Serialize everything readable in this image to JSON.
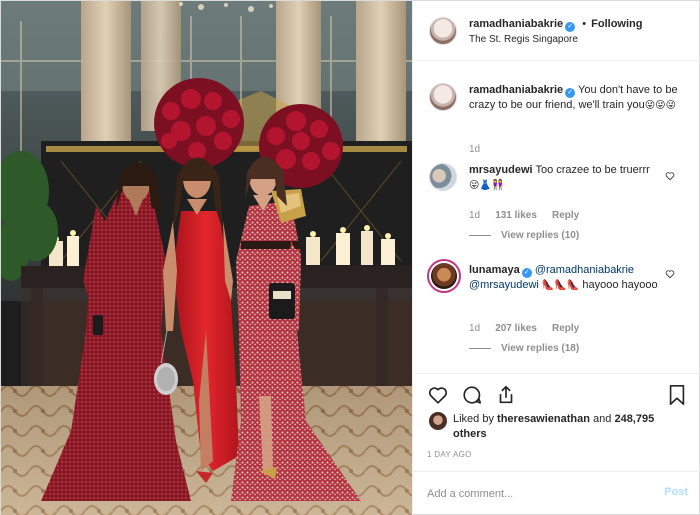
{
  "post": {
    "author": "ramadhaniabakrie",
    "follow_state": "Following",
    "location": "The St. Regis Singapore",
    "caption_user": "ramadhaniabakrie",
    "caption_text": "You don't have to be crazy to be our friend, we'll train you",
    "caption_emoji": "😜😜😜",
    "caption_age": "1d"
  },
  "comments": [
    {
      "user": "mrsayudewi",
      "verified": false,
      "text": "Too crazee to be truerrr",
      "emoji": "😜👗👭",
      "age": "1d",
      "likes": "131 likes",
      "reply_label": "Reply",
      "view_replies": "View replies (10)"
    },
    {
      "user": "lunamaya",
      "verified": true,
      "mention1": "@ramadhaniabakrie",
      "mention2": "@mrsayudewi",
      "emoji": "👠👠👠",
      "text": "hayooo hayooo",
      "age": "1d",
      "likes": "207 likes",
      "reply_label": "Reply",
      "view_replies": "View replies (18)"
    }
  ],
  "likes": {
    "prefix": "Liked by",
    "user": "theresawienathan",
    "and": "and",
    "others": "248,795 others"
  },
  "timestamp": "1 DAY AGO",
  "add_comment": {
    "placeholder": "Add a comment...",
    "post_label": "Post"
  },
  "icons": {
    "like": "heart-icon",
    "comment": "comment-icon",
    "share": "share-icon",
    "save": "bookmark-icon",
    "more": "more-options-icon"
  },
  "colors": {
    "verified": "#3897f0",
    "link": "#00376b",
    "post_disabled": "#b2dffc",
    "dress_left": "#9b1c2c",
    "dress_center": "#d91f26",
    "dress_right": "#b3343f"
  }
}
